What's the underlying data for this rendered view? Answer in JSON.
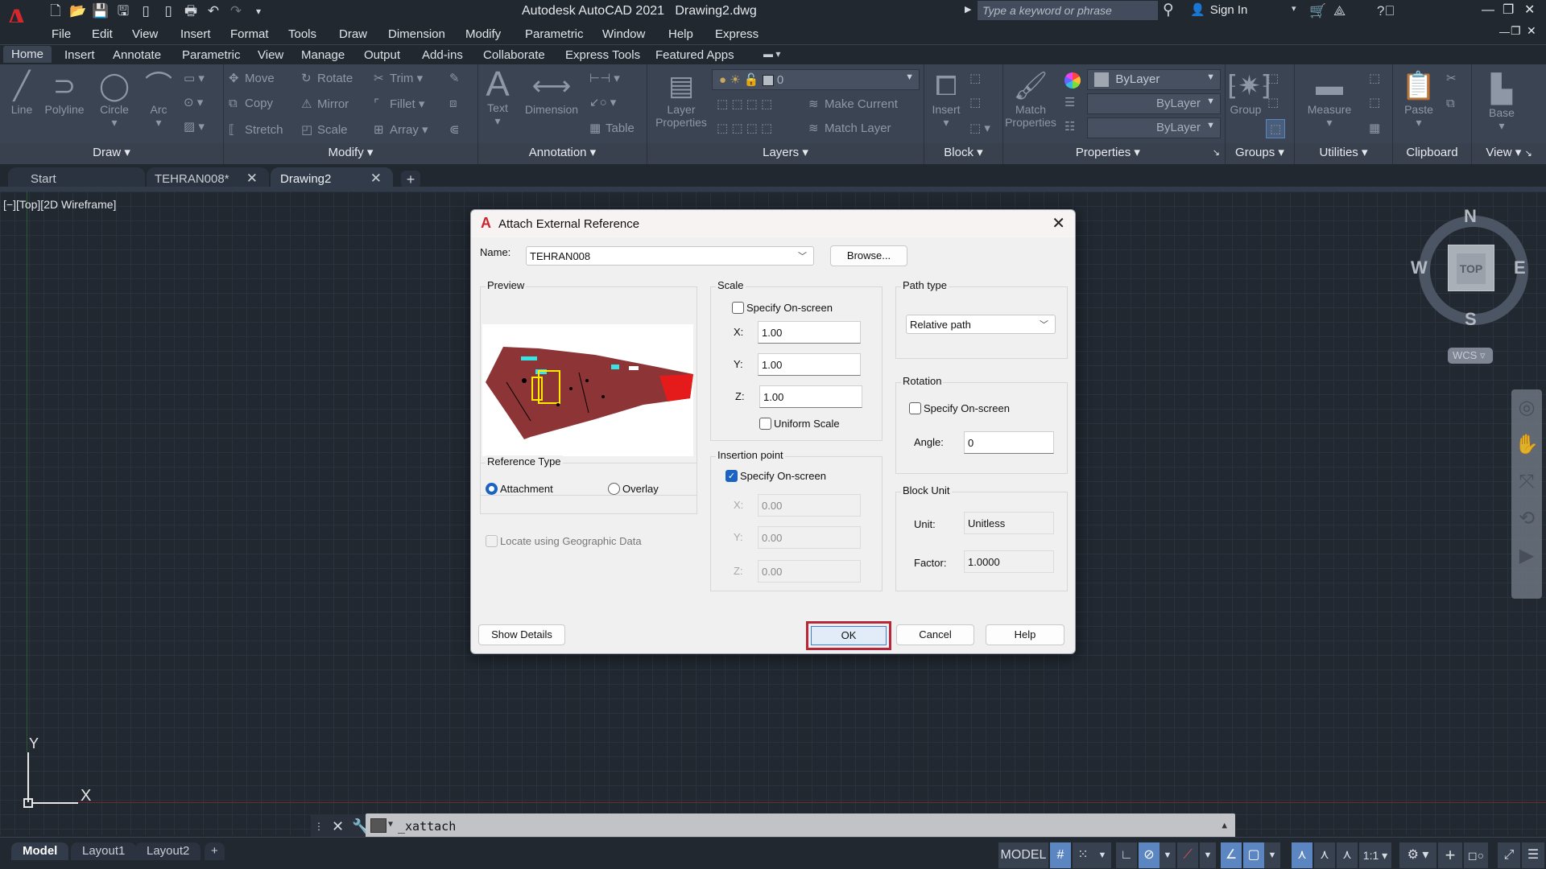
{
  "titlebar": {
    "app_title": "Autodesk AutoCAD 2021",
    "document": "Drawing2.dwg",
    "search_placeholder": "Type a keyword or phrase",
    "sign_in": "Sign In",
    "qat_icons": [
      "new-icon",
      "open-icon",
      "save-icon",
      "save-as-icon",
      "open-from-mobile-icon",
      "save-to-mobile-icon",
      "plot-icon",
      "undo-icon",
      "redo-icon",
      "customize-qat-icon"
    ]
  },
  "menubar": [
    "File",
    "Edit",
    "View",
    "Insert",
    "Format",
    "Tools",
    "Draw",
    "Dimension",
    "Modify",
    "Parametric",
    "Window",
    "Help",
    "Express"
  ],
  "ribbon_tabs": [
    "Home",
    "Insert",
    "Annotate",
    "Parametric",
    "View",
    "Manage",
    "Output",
    "Add-ins",
    "Collaborate",
    "Express Tools",
    "Featured Apps"
  ],
  "active_ribbon_tab": "Home",
  "ribbon": {
    "draw": {
      "label": "Draw",
      "tools": [
        "Line",
        "Polyline",
        "Circle",
        "Arc"
      ]
    },
    "modify": {
      "label": "Modify",
      "tools": [
        "Move",
        "Rotate",
        "Trim",
        "Copy",
        "Mirror",
        "Fillet",
        "Stretch",
        "Scale",
        "Array"
      ]
    },
    "annotation": {
      "label": "Annotation",
      "tools": [
        "Text",
        "Dimension",
        "Table"
      ]
    },
    "layers": {
      "label": "Layers",
      "layer_properties": "Layer Properties",
      "current_layer": "0",
      "make_current": "Make Current",
      "match_layer": "Match Layer"
    },
    "block": {
      "label": "Block",
      "insert": "Insert"
    },
    "properties": {
      "label": "Properties",
      "match_properties": "Match Properties",
      "color": "ByLayer",
      "lineweight": "ByLayer",
      "linetype": "ByLayer"
    },
    "groups": {
      "label": "Groups",
      "group": "Group"
    },
    "utilities": {
      "label": "Utilities",
      "measure": "Measure"
    },
    "clipboard": {
      "label": "Clipboard",
      "paste": "Paste"
    },
    "view": {
      "label": "View",
      "base": "Base"
    }
  },
  "doc_tabs": [
    {
      "label": "Start",
      "closable": false,
      "active": false
    },
    {
      "label": "TEHRAN008*",
      "closable": true,
      "active": false
    },
    {
      "label": "Drawing2",
      "closable": true,
      "active": true
    }
  ],
  "viewport": {
    "view_controls": "[−][Top][2D Wireframe]",
    "viewcube": {
      "face": "TOP",
      "north": "N",
      "south": "S",
      "east": "E",
      "west": "W",
      "ucs": "WCS"
    },
    "ucs_x": "X",
    "ucs_y": "Y"
  },
  "dialog": {
    "title": "Attach External Reference",
    "name_label": "Name:",
    "name_value": "TEHRAN008",
    "browse": "Browse...",
    "preview_label": "Preview",
    "scale": {
      "title": "Scale",
      "specify_on_screen": "Specify On-screen",
      "specify_checked": false,
      "x_label": "X:",
      "x": "1.00",
      "y_label": "Y:",
      "y": "1.00",
      "z_label": "Z:",
      "z": "1.00",
      "uniform": "Uniform Scale",
      "uniform_checked": false
    },
    "insertion": {
      "title": "Insertion point",
      "specify_on_screen": "Specify On-screen",
      "specify_checked": true,
      "x_label": "X:",
      "x": "0.00",
      "y_label": "Y:",
      "y": "0.00",
      "z_label": "Z:",
      "z": "0.00"
    },
    "path_type": {
      "title": "Path type",
      "value": "Relative path"
    },
    "rotation": {
      "title": "Rotation",
      "specify_on_screen": "Specify On-screen",
      "specify_checked": false,
      "angle_label": "Angle:",
      "angle": "0"
    },
    "block_unit": {
      "title": "Block Unit",
      "unit_label": "Unit:",
      "unit": "Unitless",
      "factor_label": "Factor:",
      "factor": "1.0000"
    },
    "reference_type": {
      "title": "Reference Type",
      "attachment": "Attachment",
      "overlay": "Overlay",
      "selected": "Attachment"
    },
    "geo": {
      "label": "Locate using Geographic Data",
      "checked": false,
      "enabled": false
    },
    "buttons": {
      "show_details": "Show Details",
      "ok": "OK",
      "cancel": "Cancel",
      "help": "Help"
    }
  },
  "command_line": {
    "text": "_xattach"
  },
  "layout_tabs": [
    "Model",
    "Layout1",
    "Layout2"
  ],
  "active_layout": "Model",
  "status_bar": {
    "model": "MODEL",
    "annotation_scale": "1:1"
  },
  "colors": {
    "accent": "#d4282f",
    "highlight": "#b8263a",
    "toggle_on": "#5b86c2",
    "checkbox": "#1a63c2"
  }
}
